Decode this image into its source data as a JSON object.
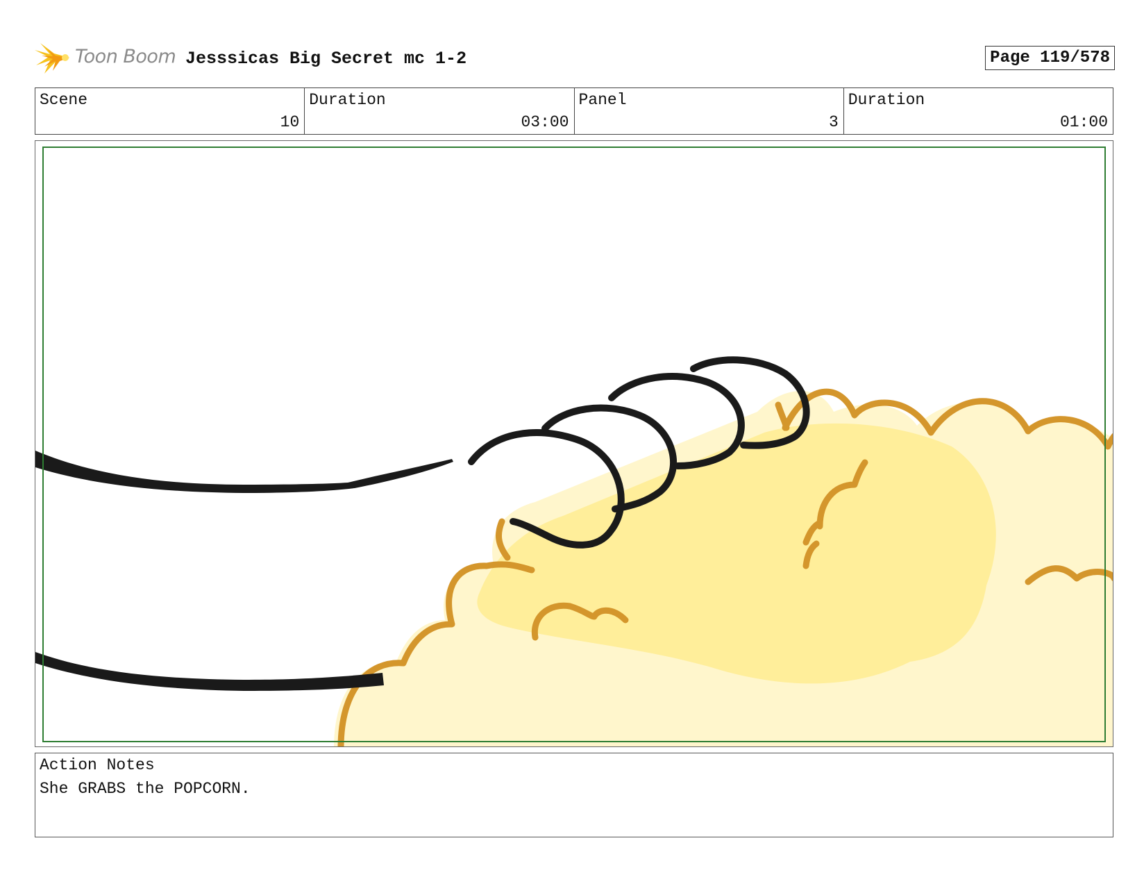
{
  "header": {
    "logo_text": "Toon Boom",
    "project_title": "Jesssicas Big Secret mc 1-2",
    "page_label": "Page 119/578"
  },
  "info": {
    "scene_label": "Scene",
    "scene_value": "10",
    "scene_duration_label": "Duration",
    "scene_duration_value": "03:00",
    "panel_label": "Panel",
    "panel_value": "3",
    "panel_duration_label": "Duration",
    "panel_duration_value": "01:00"
  },
  "notes": {
    "label": "Action Notes",
    "text": "She GRABS the POPCORN."
  },
  "colors": {
    "safe_frame": "#2e7d32",
    "popcorn_outline": "#d4962c",
    "popcorn_fill_light": "#fff6cc",
    "popcorn_fill_mid": "#ffee9a",
    "ink": "#1a1a1a"
  },
  "icons": {
    "logo": "starburst-logo-icon"
  }
}
